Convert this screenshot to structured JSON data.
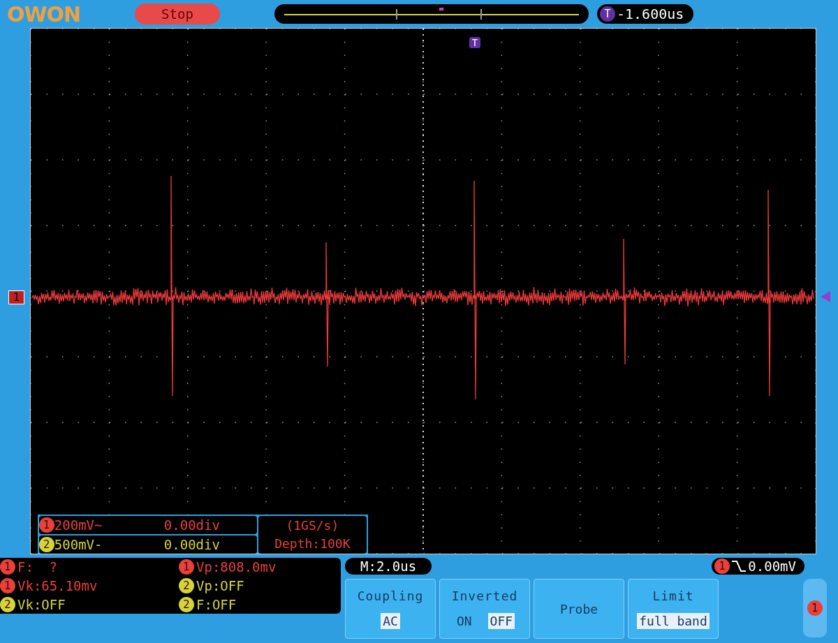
{
  "logo": "OWON",
  "run_state": "Stop",
  "trigger_position_badge": "T",
  "trigger_offset": {
    "badge": "T",
    "text": "-1.600us"
  },
  "channel_marker": "1",
  "channels": [
    {
      "badge": "1",
      "scale": "200mV~",
      "offset": "0.00div",
      "color": "#e8403a"
    },
    {
      "badge": "2",
      "scale": "500mV-",
      "offset": "0.00div",
      "color": "#d4d43a"
    }
  ],
  "acquisition": {
    "rate": "(1GS/s)",
    "depth": "Depth:100K"
  },
  "measurements": [
    {
      "badge": "1",
      "text": "F:  ?",
      "color": "#e8403a"
    },
    {
      "badge": "1",
      "text": "Vp:808.0mv",
      "color": "#e8403a"
    },
    {
      "badge": "1",
      "text": "Vk:65.10mv",
      "color": "#e8403a"
    },
    {
      "badge": "2",
      "text": "Vp:OFF",
      "color": "#d4d43a"
    },
    {
      "badge": "2",
      "text": "Vk:OFF",
      "color": "#d4d43a"
    },
    {
      "badge": "2",
      "text": "F:OFF",
      "color": "#d4d43a"
    }
  ],
  "timebase": "M:2.0us",
  "trigger_level": {
    "badge": "1",
    "text": "0.00mV"
  },
  "menu": [
    {
      "kind": "options",
      "title": "Coupling",
      "options": [
        {
          "label": "AC",
          "selected": true
        }
      ]
    },
    {
      "kind": "options",
      "title": "Inverted",
      "options": [
        {
          "label": "ON",
          "selected": false
        },
        {
          "label": "OFF",
          "selected": true
        }
      ]
    },
    {
      "kind": "plain",
      "title": "Probe"
    },
    {
      "kind": "options",
      "title": "Limit",
      "options": [
        {
          "label": "full band",
          "selected": true
        }
      ]
    }
  ],
  "menu_channel_badge": "1"
}
